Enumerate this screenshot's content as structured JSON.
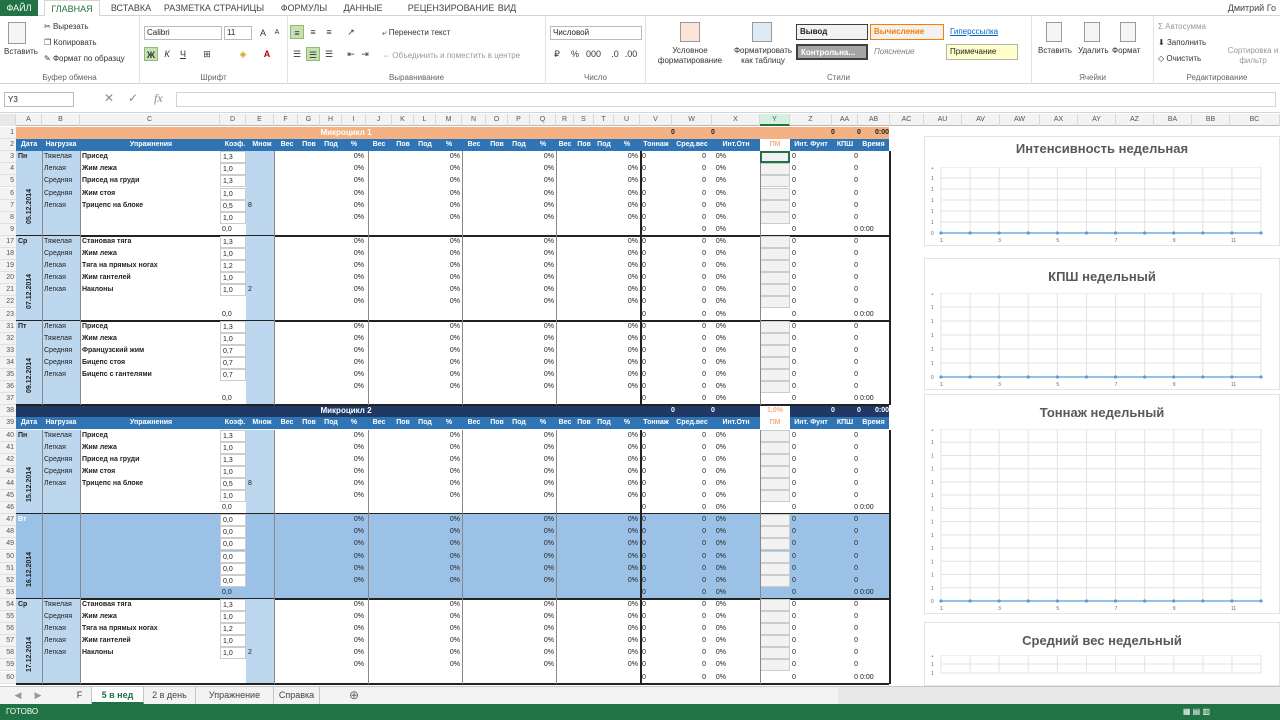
{
  "menu": {
    "tabs": [
      "ФАЙЛ",
      "ГЛАВНАЯ",
      "ВСТАВКА",
      "РАЗМЕТКА СТРАНИЦЫ",
      "ФОРМУЛЫ",
      "ДАННЫЕ",
      "РЕЦЕНЗИРОВАНИЕ",
      "ВИД"
    ],
    "active": "ГЛАВНАЯ",
    "user": "Дмитрий Го"
  },
  "ribbon": {
    "clipboard": {
      "paste": "Вставить",
      "cut": "Вырезать",
      "copy": "Копировать",
      "painter": "Формат по образцу",
      "label": "Буфер обмена"
    },
    "font": {
      "name": "Calibri",
      "size": "11",
      "bold": "Ж",
      "italic": "К",
      "underline": "Ч",
      "label": "Шрифт"
    },
    "align": {
      "wrap": "Перенести текст",
      "merge": "Объединить и поместить в центре",
      "label": "Выравнивание"
    },
    "number": {
      "format": "Числовой",
      "label": "Число"
    },
    "styles": {
      "cond": "Условное форматирование",
      "table": "Форматировать как таблицу",
      "s1": "Вывод",
      "s2": "Вычисление",
      "s3": "Гиперссылка",
      "s4": "Контрольна...",
      "s5": "Пояснение",
      "s6": "Примечание",
      "label": "Стили"
    },
    "cells": {
      "insert": "Вставить",
      "delete": "Удалить",
      "format": "Формат",
      "label": "Ячейки"
    },
    "editing": {
      "autosum": "Автосумма",
      "fill": "Заполнить",
      "clear": "Очистить",
      "sort": "Сортировка и фильтр",
      "label": "Редактирование"
    }
  },
  "formula": {
    "namebox": "Y3",
    "fx": "fx",
    "value": ""
  },
  "columns": [
    "A",
    "B",
    "C",
    "D",
    "E",
    "F",
    "G",
    "H",
    "I",
    "J",
    "K",
    "L",
    "M",
    "N",
    "O",
    "P",
    "Q",
    "R",
    "S",
    "T",
    "U",
    "V",
    "W",
    "X",
    "Y",
    "Z",
    "AA",
    "AB",
    "AC",
    "AU",
    "AV",
    "AW",
    "AX",
    "AY",
    "AZ",
    "BA",
    "BB",
    "BC"
  ],
  "selected_col": "Y",
  "sheet": {
    "micro1": "Микроцикл 1",
    "micro2": "Микроцикл 2",
    "micro1_vals": [
      "0",
      "0",
      "0",
      "0",
      "0:00"
    ],
    "micro2_vals": [
      "0",
      "0",
      "1,0%",
      "0",
      "0",
      "0:00"
    ],
    "hdr": [
      "Дата",
      "Нагрузка",
      "Упражнения",
      "Коэф.",
      "Множ",
      "Вес",
      "Пов",
      "Под",
      "%",
      "Вес",
      "Пов",
      "Под",
      "%",
      "Вес",
      "Пов",
      "Под",
      "%",
      "Вес",
      "Пов",
      "Под",
      "%",
      "Тоннаж",
      "Сред.вес",
      "Инт.Отн",
      "ПМ",
      "Инт. Фунт",
      "КПШ",
      "Время"
    ],
    "blocks": [
      {
        "rows": [
          "3",
          "4",
          "5",
          "6",
          "7",
          "8",
          "9"
        ],
        "day": "Пн",
        "date": "05.12.2014",
        "mult": "8",
        "items": [
          [
            "Тяжелая",
            "Присед",
            "1,3"
          ],
          [
            "Легкая",
            "Жим лежа",
            "1,0"
          ],
          [
            "Средняя",
            "Присед на груди",
            "1,3"
          ],
          [
            "Средняя",
            "Жим стоя",
            "1,0"
          ],
          [
            "Легкая",
            "Трицепс на блоке",
            "0,5"
          ],
          [
            "",
            "",
            "1,0"
          ]
        ],
        "tot": "0,0"
      },
      {
        "rows": [
          "17",
          "18",
          "19",
          "20",
          "21",
          "22",
          "23"
        ],
        "day": "Ср",
        "date": "07.12.2014",
        "mult": "2",
        "items": [
          [
            "Тяжелая",
            "Становая тяга",
            "1,3"
          ],
          [
            "Средняя",
            "Жим лежа",
            "1,0"
          ],
          [
            "Легкая",
            "Тяга на прямых ногах",
            "1,2"
          ],
          [
            "Легкая",
            "Жим гантелей",
            "1,0"
          ],
          [
            "Легкая",
            "Наклоны",
            "1,0"
          ],
          [
            "",
            "",
            ""
          ]
        ],
        "tot": "0,0"
      },
      {
        "rows": [
          "31",
          "32",
          "33",
          "34",
          "35",
          "36",
          "37"
        ],
        "day": "Пт",
        "date": "09.12.2014",
        "mult": "",
        "items": [
          [
            "Легкая",
            "Присед",
            "1,3"
          ],
          [
            "Тяжелая",
            "Жим лежа",
            "1,0"
          ],
          [
            "Средняя",
            "Французский жим",
            "0,7"
          ],
          [
            "Средняя",
            "Бицепс стоя",
            "0,7"
          ],
          [
            "Легкая",
            "Бицепс с гантелями",
            "0,7"
          ],
          [
            "",
            "",
            ""
          ]
        ],
        "tot": "0,0"
      },
      {
        "rows": [
          "40",
          "41",
          "42",
          "43",
          "44",
          "45",
          "46"
        ],
        "day": "Пн",
        "date": "15.12.2014",
        "mult": "8",
        "items": [
          [
            "Тяжелая",
            "Присед",
            "1,3"
          ],
          [
            "Легкая",
            "Жим лежа",
            "1,0"
          ],
          [
            "Средняя",
            "Присед на груди",
            "1,3"
          ],
          [
            "Средняя",
            "Жим стоя",
            "1,0"
          ],
          [
            "Легкая",
            "Трицепс на блоке",
            "0,5"
          ],
          [
            "",
            "",
            "1,0"
          ]
        ],
        "tot": "0,0"
      },
      {
        "rows": [
          "47",
          "48",
          "49",
          "50",
          "51",
          "52",
          "53"
        ],
        "day": "Вт",
        "date": "16.12.2014",
        "mult": "",
        "items": [
          [
            "",
            "",
            "0,0"
          ],
          [
            "",
            "",
            "0,0"
          ],
          [
            "",
            "",
            "0,0"
          ],
          [
            "",
            "",
            "0,0"
          ],
          [
            "",
            "",
            "0,0"
          ],
          [
            "",
            "",
            "0,0"
          ]
        ],
        "tot": "0,0",
        "blank": true
      },
      {
        "rows": [
          "54",
          "55",
          "56",
          "57",
          "58",
          "59",
          "60"
        ],
        "day": "Ср",
        "date": "17.12.2014",
        "mult": "2",
        "items": [
          [
            "Тяжелая",
            "Становая тяга",
            "1,3"
          ],
          [
            "Средняя",
            "Жим лежа",
            "1,0"
          ],
          [
            "Легкая",
            "Тяга на прямых ногах",
            "1,2"
          ],
          [
            "Легкая",
            "Жим гантелей",
            "1,0"
          ],
          [
            "Легкая",
            "Наклоны",
            "1,0"
          ],
          [
            "",
            "",
            ""
          ]
        ],
        "tot": ""
      }
    ],
    "zero": "0",
    "pct": "0%",
    "time": "0:00"
  },
  "charts": [
    {
      "title": "Интенсивность недельная"
    },
    {
      "title": "КПШ недельный"
    },
    {
      "title": "Тоннаж недельный"
    },
    {
      "title": "Средний вес недельный"
    }
  ],
  "chart_data": [
    {
      "type": "line",
      "title": "Интенсивность недельная",
      "x": [
        1,
        2,
        3,
        4,
        5,
        6,
        7,
        8,
        9,
        10,
        11,
        12
      ],
      "series": [
        {
          "values": [
            0,
            0,
            0,
            0,
            0,
            0,
            0,
            0,
            0,
            0,
            0,
            0
          ]
        }
      ],
      "xticks": [
        "1",
        "3",
        "5",
        "7",
        "9",
        "11"
      ],
      "yticks": [
        "0",
        "1",
        "1",
        "1",
        "1",
        "1",
        "1"
      ],
      "grid": true
    },
    {
      "type": "line",
      "title": "КПШ недельный",
      "x": [
        1,
        2,
        3,
        4,
        5,
        6,
        7,
        8,
        9,
        10,
        11,
        12
      ],
      "series": [
        {
          "values": [
            0,
            0,
            0,
            0,
            0,
            0,
            0,
            0,
            0,
            0,
            0,
            0
          ]
        }
      ],
      "xticks": [
        "1",
        "3",
        "5",
        "7",
        "9",
        "11"
      ],
      "yticks": [
        "0",
        "1",
        "1",
        "1",
        "1",
        "1",
        "1"
      ],
      "grid": true
    },
    {
      "type": "line",
      "title": "Тоннаж недельный",
      "x": [
        1,
        2,
        3,
        4,
        5,
        6,
        7,
        8,
        9,
        10,
        11,
        12
      ],
      "series": [
        {
          "values": [
            0,
            0,
            0,
            0,
            0,
            0,
            0,
            0,
            0,
            0,
            0,
            0
          ]
        }
      ],
      "xticks": [
        "1",
        "3",
        "5",
        "7",
        "9",
        "11"
      ],
      "yticks": [
        "0",
        "1",
        "1",
        "1",
        "1",
        "1",
        "1",
        "1",
        "1",
        "1",
        "1",
        "1",
        "1",
        "1"
      ],
      "grid": true
    },
    {
      "type": "line",
      "title": "Средний вес недельный",
      "x": [
        1,
        2,
        3,
        4,
        5,
        6,
        7,
        8,
        9,
        10,
        11,
        12
      ],
      "series": [
        {
          "values": []
        }
      ],
      "xticks": [],
      "yticks": [
        "1",
        "1",
        "1"
      ],
      "grid": true
    }
  ],
  "tabs": [
    "F",
    "5 в нед",
    "2 в день",
    "Упражнение",
    "Справка"
  ],
  "active_tab": "5 в нед",
  "status": "ГОТОВО"
}
